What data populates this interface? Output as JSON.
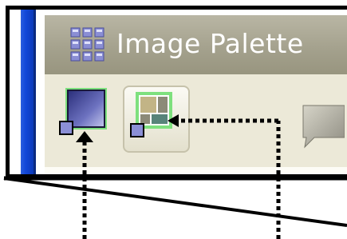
{
  "palette": {
    "title": "Image Palette",
    "icons": [
      "grid-icon",
      "color-swatch-icon",
      "layout-swatch-icon",
      "speech-bubble-icon"
    ]
  },
  "colors": {
    "frame": "#000000",
    "left_strip": "#1247d8",
    "titlebar": "#a3a08c",
    "toolbar": "#ece9d8",
    "highlight_green": "#7ee07e"
  }
}
